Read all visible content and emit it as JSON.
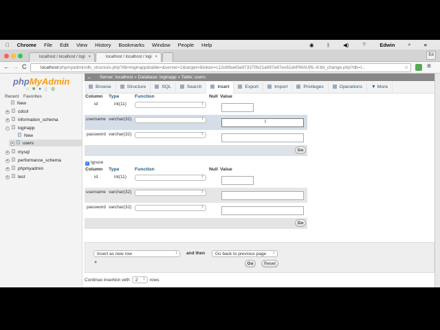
{
  "menubar": {
    "app": "Chrome",
    "items": [
      "File",
      "Edit",
      "View",
      "History",
      "Bookmarks",
      "Window",
      "People",
      "Help"
    ],
    "user": "Edwin"
  },
  "browser": {
    "tabs": [
      {
        "label": "localhost / localhost / logi",
        "active": false
      },
      {
        "label": "localhost / localhost / logi",
        "active": true
      }
    ],
    "profile": "Ed",
    "url_host": "localhost",
    "url_path": "/phpmyadmin/db_structure.php?db=loginapp&table=&server=1&target=&token=c12c6fba43a973370b21a697e87ec61d#PMAURL-6:tbl_change.php?db=l..."
  },
  "sidebar": {
    "logo_php": "php",
    "logo_myadmin": "MyAdmin",
    "recent": "Recent",
    "favorites": "Favorites",
    "tree": [
      {
        "label": "New",
        "level": 0,
        "kind": "new"
      },
      {
        "label": "cdcol",
        "level": 0
      },
      {
        "label": "information_schema",
        "level": 0
      },
      {
        "label": "loginapp",
        "level": 0,
        "expanded": true
      },
      {
        "label": "New",
        "level": 1,
        "kind": "new"
      },
      {
        "label": "users",
        "level": 1,
        "selected": true
      },
      {
        "label": "mysql",
        "level": 0
      },
      {
        "label": "performance_schema",
        "level": 0
      },
      {
        "label": "phpmyadmin",
        "level": 0
      },
      {
        "label": "test",
        "level": 0
      }
    ]
  },
  "breadcrumb": {
    "server": "Server: localhost",
    "database": "Database: loginapp",
    "table": "Table: users"
  },
  "tabs": [
    "Browse",
    "Structure",
    "SQL",
    "Search",
    "Insert",
    "Export",
    "Import",
    "Privileges",
    "Operations",
    "More"
  ],
  "active_tab": "Insert",
  "headers": {
    "column": "Column",
    "type": "Type",
    "function": "Function",
    "null": "Null",
    "value": "Value"
  },
  "rows": [
    {
      "column": "id",
      "type": "int(11)"
    },
    {
      "column": "username",
      "type": "varchar(32)"
    },
    {
      "column": "password",
      "type": "varchar(32)"
    }
  ],
  "go_label": "Go",
  "ignore_label": "Ignore",
  "ignore_checked": true,
  "bottom": {
    "insert_mode": "Insert as new row",
    "and_then": "and then",
    "after": "Go back to previous page",
    "go": "Go",
    "reset": "Reset",
    "continue_prefix": "Continue insertion with",
    "continue_count": "2",
    "continue_suffix": "rows"
  },
  "colors": {
    "link": "#235a81",
    "logo_blue": "#6c78af",
    "logo_orange": "#f89c0e",
    "row_highlight": "#d5dde8"
  }
}
